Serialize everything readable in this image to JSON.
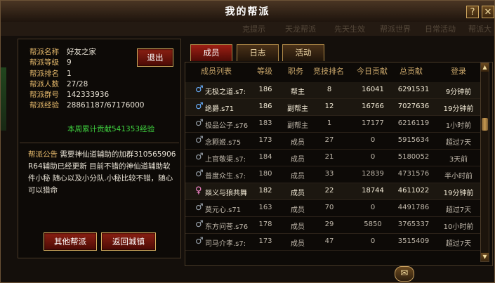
{
  "window": {
    "title": "我的帮派",
    "help_label": "?",
    "close_label": "✕"
  },
  "strip": {
    "texts": [
      "克提示",
      "天龙帮派",
      "先天生效",
      "帮派世界",
      "日常活动",
      "帮派大"
    ]
  },
  "guild": {
    "name_label": "帮派名称",
    "name": "好友之家",
    "level_label": "帮派等级",
    "level": "9",
    "rank_label": "帮派排名",
    "rank": "1",
    "members_label": "帮派人数",
    "members": "27/28",
    "group_label": "帮派群号",
    "group": "142333936",
    "exp_label": "帮派经验",
    "exp": "28861187/67176000",
    "contribution_note": "本周累计贡献541353经验",
    "notice_label": "帮派公告",
    "notice_text": "需要神仙道辅助的加群310565906    R64辅助已经更新    目前不错的神仙道辅助软件小秘  随心以及小分队.小秘比较不错，随心可以猎命"
  },
  "buttons": {
    "exit": "退出",
    "other_guild": "其他帮派",
    "return_city": "返回城镇"
  },
  "tabs": [
    {
      "label": "成员"
    },
    {
      "label": "日志"
    },
    {
      "label": "活动"
    }
  ],
  "table": {
    "headers": {
      "name": "成员列表",
      "level": "等级",
      "role": "职务",
      "score": "竞技排名",
      "today": "今日贡献",
      "total": "总贡献",
      "login": "登录"
    },
    "rows": [
      {
        "gender": "♂",
        "name": "无极之道.s7:",
        "level": "186",
        "role": "帮主",
        "score": "8",
        "today": "16041",
        "total": "6291531",
        "login": "9分钟前",
        "highlight": true
      },
      {
        "gender": "♂",
        "name": "绝爵.s71",
        "level": "186",
        "role": "副帮主",
        "score": "12",
        "today": "16766",
        "total": "7027636",
        "login": "19分钟前",
        "highlight": true
      },
      {
        "gender": "♂",
        "name": "极品公子.s76",
        "level": "183",
        "role": "副帮主",
        "score": "1",
        "today": "17177",
        "total": "6216119",
        "login": "1小时前",
        "highlight": false
      },
      {
        "gender": "♂",
        "name": "念颗姬.s75",
        "level": "173",
        "role": "成员",
        "score": "27",
        "today": "0",
        "total": "5915634",
        "login": "超过7天",
        "highlight": false
      },
      {
        "gender": "♂",
        "name": "上官敬渠.s7:",
        "level": "184",
        "role": "成员",
        "score": "21",
        "today": "0",
        "total": "5180052",
        "login": "3天前",
        "highlight": false
      },
      {
        "gender": "♂",
        "name": "普度众生.s7:",
        "level": "180",
        "role": "成员",
        "score": "33",
        "today": "12839",
        "total": "4731576",
        "login": "半小时前",
        "highlight": false
      },
      {
        "gender": "♀",
        "name": "燚义与狼共舞",
        "level": "182",
        "role": "成员",
        "score": "22",
        "today": "18744",
        "total": "4611022",
        "login": "19分钟前",
        "highlight": true
      },
      {
        "gender": "♂",
        "name": "莫元心.s71",
        "level": "163",
        "role": "成员",
        "score": "70",
        "today": "0",
        "total": "4491786",
        "login": "超过7天",
        "highlight": false
      },
      {
        "gender": "♂",
        "name": "东方问苍.s76",
        "level": "178",
        "role": "成员",
        "score": "29",
        "today": "5850",
        "total": "3765337",
        "login": "10小时前",
        "highlight": false
      },
      {
        "gender": "♂",
        "name": "司马介孝.s7:",
        "level": "173",
        "role": "成员",
        "score": "47",
        "today": "0",
        "total": "3515409",
        "login": "超过7天",
        "highlight": false
      }
    ]
  },
  "scroll": {
    "up": "▲",
    "down": "▼"
  },
  "mail_icon": "✉"
}
